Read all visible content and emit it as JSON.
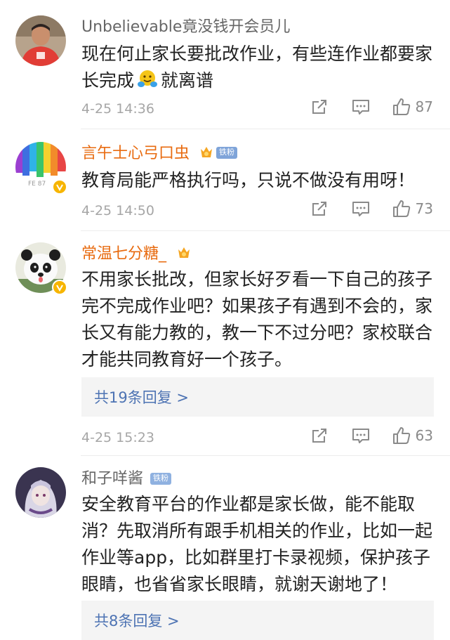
{
  "comments": [
    {
      "username": "Unbelievable竟没钱开会员儿",
      "text_before_emoji": "现在何止家长要批改作业，有些连作业都要家长完成",
      "emoji": "hug-emoji",
      "text_after_emoji": "就离谱",
      "time": "4-25 14:36",
      "likes": "87"
    },
    {
      "username": "言午士心弓口虫",
      "fan_badge": "铁粉",
      "verified": true,
      "text": "教育局能严格执行吗，只说不做没有用呀！",
      "time": "4-25 14:50",
      "likes": "73"
    },
    {
      "username": "常温七分糖_",
      "verified": true,
      "text": "不用家长批改，但家长好歹看一下自己的孩子完不完成作业吧？如果孩子有遇到不会的，家长又有能力教的，教一下不过分吧？家校联合才能共同教育好一个孩子。",
      "replies": "共19条回复 >",
      "time": "4-25 15:23",
      "likes": "63"
    },
    {
      "username": "和子咩酱",
      "fan_badge": "铁粉",
      "text": "安全教育平台的作业都是家长做，能不能取消？先取消所有跟手机相关的作业，比如一起作业等app，比如群里打卡录视频，保护孩子眼睛，也省省家长眼睛，就谢天谢地了！",
      "replies": "共8条回复 >"
    }
  ],
  "icons": {
    "share": "share-icon",
    "comment": "comment-icon",
    "like": "thumbs-up-icon",
    "crown": "crown-badge-icon",
    "verified": "verified-v-icon"
  },
  "colors": {
    "username_highlight": "#e86b10",
    "username_plain": "#666666",
    "reply_link": "#4d73b3",
    "fan_badge": "#7fa4d9",
    "verified": "#f7b500"
  }
}
